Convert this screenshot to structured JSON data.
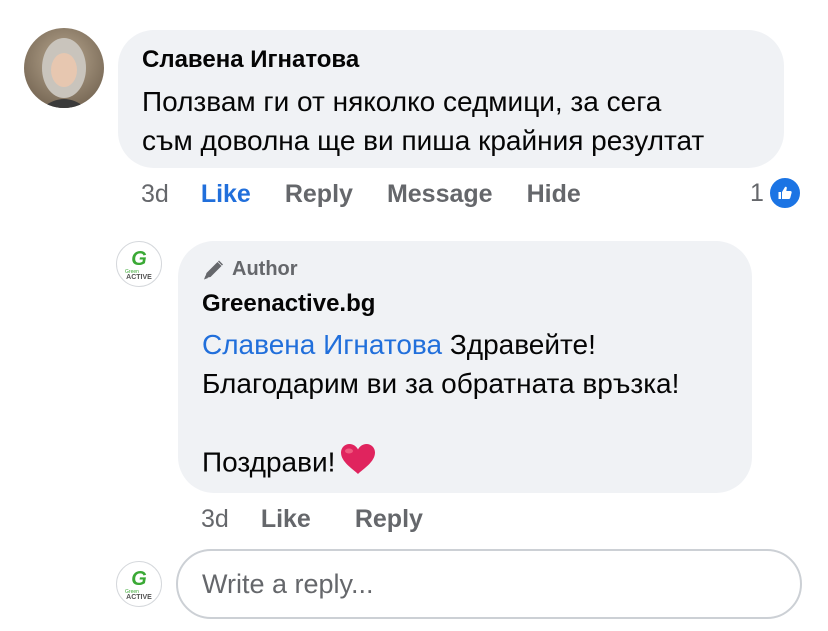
{
  "comment": {
    "author": "Славена Игнатова",
    "text_line1": "Ползвам ги от няколко седмици, за сега",
    "text_line2": "съм доволна ще ви пиша крайния резултат",
    "time": "3d",
    "actions": {
      "like": "Like",
      "reply": "Reply",
      "message": "Message",
      "hide": "Hide"
    },
    "reaction_count": "1",
    "reaction_icon": "thumbs-up-icon"
  },
  "reply": {
    "badge": "Author",
    "badge_icon": "pencil-icon",
    "author": "Greenactive.bg",
    "mention": "Славена Игнатова",
    "text_line1_rest": " Здравейте!",
    "text_line2": "Благодарим ви за обратната връзка!",
    "text_line4": "Поздрави!",
    "emoji": "heart-emoji",
    "time": "3d",
    "actions": {
      "like": "Like",
      "reply": "Reply"
    },
    "brand_logo": {
      "letter": "G",
      "small_text": "Green",
      "bottom_text": "ACTIVE"
    }
  },
  "reply_box": {
    "placeholder": "Write a reply..."
  },
  "colors": {
    "bubble_bg": "#f0f2f5",
    "link_blue": "#216fdb",
    "muted_gray": "#65676b",
    "brand_green": "#3aa935",
    "like_blue": "#1b74e4",
    "heart_red": "#e0245e"
  }
}
